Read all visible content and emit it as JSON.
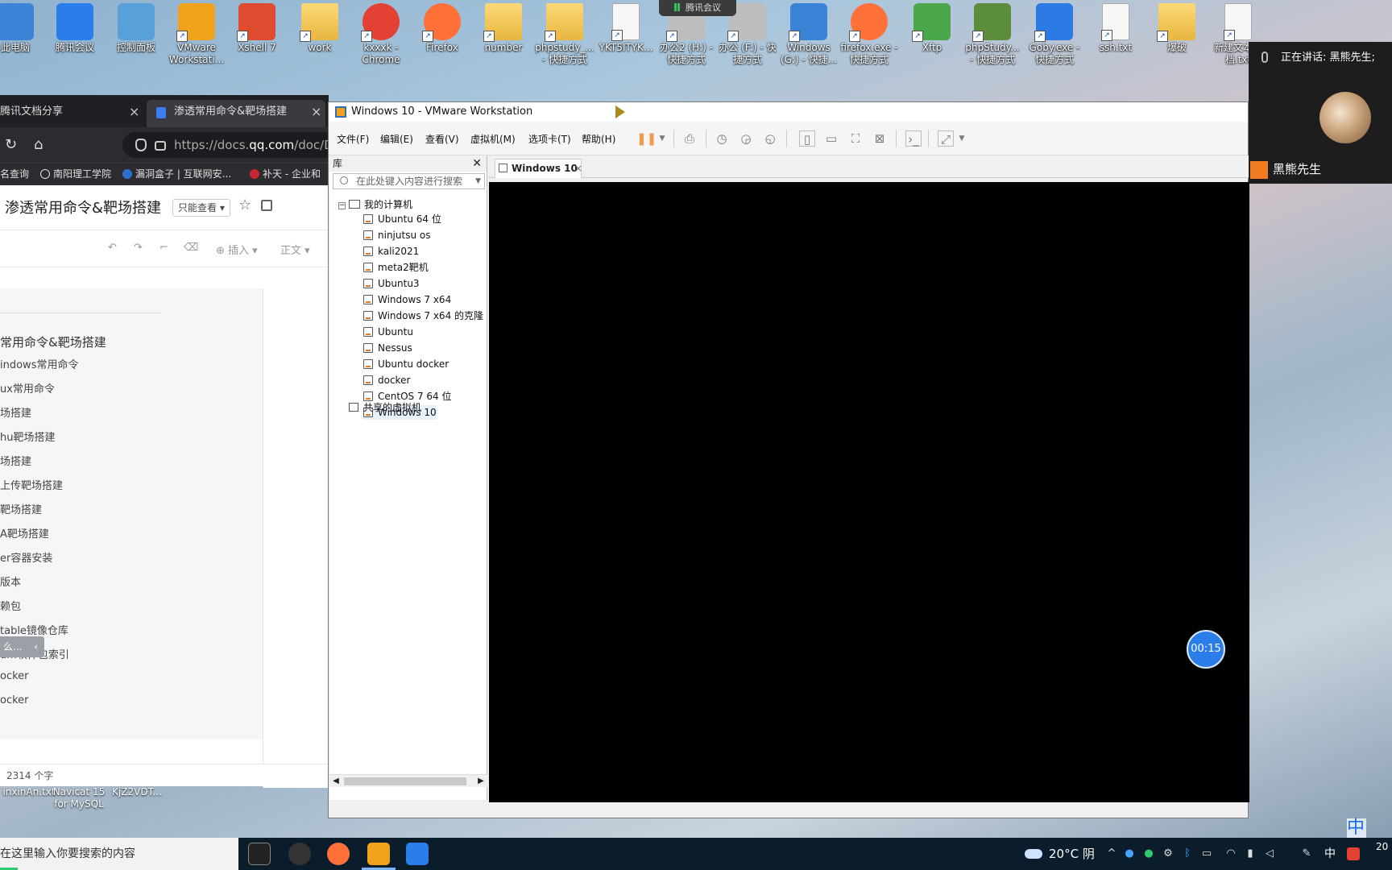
{
  "desktop": {
    "icons": [
      {
        "label": "此电脑",
        "name": "this-pc",
        "color": "#3a83d6"
      },
      {
        "label": "腾讯会议",
        "name": "tencent-meeting",
        "color": "#2b7de9"
      },
      {
        "label": "控制面板",
        "name": "control-panel",
        "color": "#5aa0d8"
      },
      {
        "label": "VMware Workstati...",
        "name": "vmware-workstation",
        "color": "#f0a21d"
      },
      {
        "label": "Xshell 7",
        "name": "xshell",
        "color": "#e04b2f"
      },
      {
        "label": "work",
        "name": "work-folder",
        "color": "folder"
      },
      {
        "label": "kxxxk - Chrome",
        "name": "chrome",
        "color": "#e34133"
      },
      {
        "label": "Firefox",
        "name": "firefox",
        "color": "#ff7139"
      },
      {
        "label": "number",
        "name": "number-folder",
        "color": "folder"
      },
      {
        "label": "phpstudy_... - 快捷方式",
        "name": "phpstudy-shortcut",
        "color": "folder"
      },
      {
        "label": "YKT5ITYK...",
        "name": "ykt-file",
        "color": "doc"
      },
      {
        "label": "办公2 (H:) - 快捷方式",
        "name": "office2-drive",
        "color": "#bdbdbd"
      },
      {
        "label": "办公 (F:) - 快捷方式",
        "name": "office-drive",
        "color": "#bdbdbd"
      },
      {
        "label": "Windows (G:) - 快捷...",
        "name": "windows-drive",
        "color": "#3a83d6"
      },
      {
        "label": "firefox.exe - 快捷方式",
        "name": "firefox-exe",
        "color": "#ff7139"
      },
      {
        "label": "Xftp",
        "name": "xftp",
        "color": "#4aa84a"
      },
      {
        "label": "phpStudy... - 快捷方式",
        "name": "phpstudy2",
        "color": "#5b8d3a"
      },
      {
        "label": "Goby.exe - 快捷方式",
        "name": "goby",
        "color": "#2c7be5"
      },
      {
        "label": "ssh.txt",
        "name": "ssh-txt",
        "color": "doc"
      },
      {
        "label": "爆破",
        "name": "bruteforce-folder",
        "color": "folder"
      },
      {
        "label": "新建文本文档.txt",
        "name": "new-text-doc",
        "color": "doc"
      }
    ],
    "bottom_icons": [
      "inxinAn.txt",
      "Navicat 15 for MySQL",
      "KjZ2VDT..."
    ],
    "meeting_pill": "腾讯会议"
  },
  "browser": {
    "tabs": [
      {
        "label": "腾讯文档分享",
        "active": false
      },
      {
        "label": "渗透常用命令&靶场搭建",
        "active": true
      }
    ],
    "url_prefix": "https://docs.",
    "url_domain": "qq.com",
    "url_path": "/doc/DV",
    "bookmarks": [
      "名查询",
      "南阳理工学院",
      "漏洞盒子 | 互联网安...",
      "补天 - 企业和"
    ],
    "doc_title": "渗透常用命令&靶场搭建",
    "readonly_label": "只能查看 ▾",
    "toolbar": {
      "insert": "插入 ▾",
      "style": "正文 ▾"
    },
    "outline_title": "常用命令&靶场搭建",
    "outline": [
      "indows常用命令",
      "ux常用命令",
      "场搭建",
      "hu靶场搭建",
      "场搭建",
      "上传靶场搭建",
      "靶场搭建",
      "A靶场搭建",
      "er容器安装",
      "版本",
      "赖包",
      "table镜像仓库",
      "um软件包索引",
      "ocker",
      "ocker"
    ],
    "outline_collapse": "么...",
    "word_count": "2314 个字"
  },
  "vmware": {
    "title": "Windows 10  - VMware Workstation",
    "menus": [
      "文件(F)",
      "编辑(E)",
      "查看(V)",
      "虚拟机(M)",
      "选项卡(T)",
      "帮助(H)"
    ],
    "library_label": "库",
    "search_placeholder": "在此处键入内容进行搜索",
    "my_computer": "我的计算机",
    "vms": [
      "Ubuntu 64 位",
      "ninjutsu os",
      "kali2021",
      "meta2靶机",
      "Ubuntu3",
      "Windows 7 x64",
      "Windows 7 x64 的克隆",
      "Ubuntu",
      "Nessus",
      "Ubuntu docker",
      "docker",
      "CentOS 7 64 位",
      "Windows 10"
    ],
    "selected_vm": "Windows 10",
    "shared_vms": "共享的虚拟机",
    "open_tab": "Windows 10",
    "timer": "00:15"
  },
  "meeting": {
    "speaking": "正在讲话: 黑熊先生;",
    "speaker_name": "黑熊先生"
  },
  "taskbar": {
    "search_placeholder": "在这里输入你要搜索的内容",
    "weather": "20°C 阴",
    "ime": "中",
    "clock": "20"
  }
}
